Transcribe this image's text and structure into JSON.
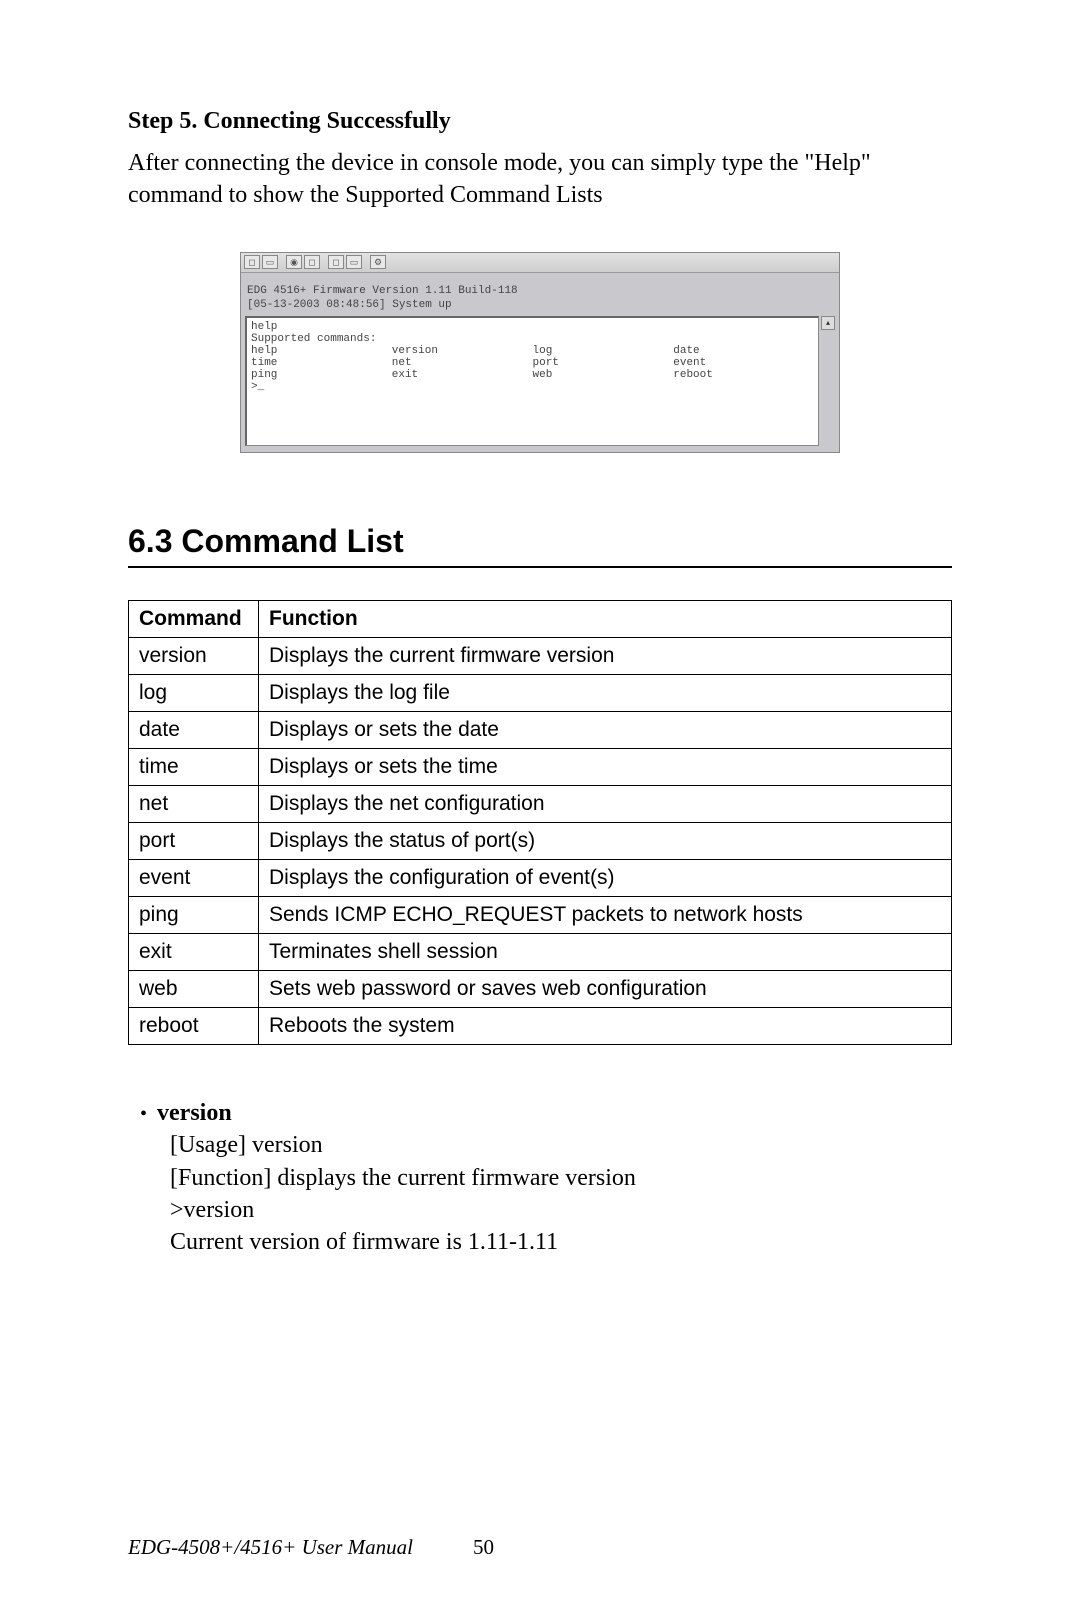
{
  "step": {
    "heading": "Step 5. Connecting Successfully",
    "body": "After connecting the device in console mode, you can simply type the \"Help\" command to show the Supported Command Lists"
  },
  "console": {
    "info1": "EDG 4516+ Firmware Version 1.11 Build-118",
    "info2": "[05-13-2003 08:48:56] System up",
    "help_cmd": "help",
    "supported_label": "Supported commands:",
    "rows": [
      [
        "help",
        "version",
        "log",
        "date"
      ],
      [
        "time",
        "net",
        "port",
        "event"
      ],
      [
        "ping",
        "exit",
        "web",
        "reboot"
      ]
    ],
    "prompt": ">_"
  },
  "section": {
    "number": "6.3",
    "title": "Command List",
    "heading": "6.3  Command List"
  },
  "table": {
    "head_cmd": "Command",
    "head_func": "Function",
    "rows": [
      {
        "cmd": "version",
        "func": "Displays the current firmware version"
      },
      {
        "cmd": "log",
        "func": "Displays the log file"
      },
      {
        "cmd": "date",
        "func": "Displays or sets the date"
      },
      {
        "cmd": "time",
        "func": "Displays or sets the time"
      },
      {
        "cmd": "net",
        "func": "Displays the net configuration"
      },
      {
        "cmd": "port",
        "func": "Displays the status of port(s)"
      },
      {
        "cmd": "event",
        "func": "Displays the configuration of event(s)"
      },
      {
        "cmd": "ping",
        "func": "Sends ICMP ECHO_REQUEST packets to network hosts"
      },
      {
        "cmd": "exit",
        "func": "Terminates shell session"
      },
      {
        "cmd": "web",
        "func": "Sets web password or saves web configuration"
      },
      {
        "cmd": "reboot",
        "func": "Reboots the system"
      }
    ]
  },
  "version_block": {
    "head": "version",
    "line1": "[Usage] version",
    "line2": "[Function] displays the current firmware version",
    "line3": ">version",
    "line4": "Current version of firmware is 1.11-1.11"
  },
  "footer": {
    "title": "EDG-4508+/4516+ User Manual",
    "page": "50"
  }
}
